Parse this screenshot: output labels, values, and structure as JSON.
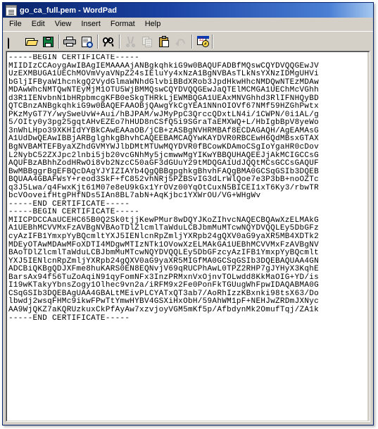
{
  "window": {
    "title": "go_ca_full.pem - WordPad",
    "icon": "wordpad-document-icon",
    "titlebar_color": "#0a246a",
    "chrome_color": "#d4d0c8"
  },
  "menubar": {
    "items": [
      {
        "label": "File",
        "name": "menu-file"
      },
      {
        "label": "Edit",
        "name": "menu-edit"
      },
      {
        "label": "View",
        "name": "menu-view"
      },
      {
        "label": "Insert",
        "name": "menu-insert"
      },
      {
        "label": "Format",
        "name": "menu-format"
      },
      {
        "label": "Help",
        "name": "menu-help"
      }
    ]
  },
  "toolbar": {
    "buttons": [
      {
        "name": "new-button",
        "icon": "new-document-icon",
        "enabled": true
      },
      {
        "name": "open-button",
        "icon": "open-folder-icon",
        "enabled": true
      },
      {
        "name": "save-button",
        "icon": "save-floppy-icon",
        "enabled": true
      },
      {
        "name": "print-button",
        "icon": "printer-icon",
        "enabled": true
      },
      {
        "name": "print-preview-button",
        "icon": "print-preview-icon",
        "enabled": true
      },
      {
        "name": "find-button",
        "icon": "binoculars-find-icon",
        "enabled": true
      },
      {
        "name": "cut-button",
        "icon": "scissors-cut-icon",
        "enabled": false
      },
      {
        "name": "copy-button",
        "icon": "copy-pages-icon",
        "enabled": false
      },
      {
        "name": "paste-button",
        "icon": "clipboard-paste-icon",
        "enabled": true
      },
      {
        "name": "undo-button",
        "icon": "undo-arrow-icon",
        "enabled": false
      },
      {
        "name": "date-time-button",
        "icon": "calendar-clock-icon",
        "enabled": true
      }
    ]
  },
  "document": {
    "lines": [
      "-----BEGIN CERTIFICATE-----",
      "MIIDIzCCAoygAwIBAgIEMAAAAjANBgkqhkiG9w0BAQUFADBfMQswCQYDVQQGEwJV",
      "UzEXMBUGA1UEChMOVmVyaVNpZ24sIEluYy4xNzA1BgNVBAsTLkNsYXNzIDMgUHVi",
      "bGljIFByaW1hcnkgQ2VydGlmaWNhdGlvbiBBdXRob3JpdHkwHhcNMDQwNTEzMDAw",
      "MDAwWhcNMTQwNTEyMjM1OTU5WjBMMQswCQYDVQQGEwJaQTElMCMGA1UEChMcVGhh",
      "d3R1IENvbnN1bHRpbmcgKFB0eSkgTHRkLjEWMBQGA1UEAxMNVGhhd3RlIFNHQyBD",
      "QTCBnzANBgkqhkiG9w0BAQEFAAOBjQAwgYkCgYEA1NNnOIOVf67NMf59HZGhPwtx",
      "PKzMyGT7Y/wySweUvW+Aui/hBJPAM/wJMyPpC3QrccQDxtLN4i/1CWPN/0i1AL/g",
      "5/OIty0y3pg25gqtAHvEZEo7hHUD8nCSfQ5i9SGraTaEMXWQ+L/HbIgbBpV8yeWo",
      "3nWhLHpo39XKHIdYYBkCAwEAAaOB/jCB+zASBgNVHRMBAf8ECDAGAQH/AgEAMAsG",
      "A1UdDwQEAwIBBjARBglghkgBhvhCAQEEBAMCAQYwKAYDVR0RBCEwH6QdMBsxGTAX",
      "BgNVBAMTEFByaXZhdGVMYWJlbDMtMTUwMQYDVR0fBCowKDAmoCSgIoYgaHR0cDov",
      "L2NybC52ZXJpc2lnbi5jb20vcGNhMy5jcmwwMgYIKwYBBQUHAQEEJjAkMCIGCCsG",
      "AQUFBzABhhZodHRwOi8vb2NzcC50aGF3dGUuY29tMDQGA1UdJQQtMCsGCCsGAQUF",
      "BwMBBggrBgEFBQcDAgYJYIZIAYb4QgQBBgpghkgBhvhFAQgBMA0GCSqGSIb3DQEB",
      "BQUAA4GBAFWsY+reod3SkF+fC852vhNRj5PZBSvIG3dLrWlQoe7e3P3bB+noOZTc",
      "q3J5Lwa/q4FwxKjt61M07e8eU9kGx1YrOVz00YqOtCuxN5BICEI1xT6Ky3/rbwTR",
      "bcVOoveifHtgPHfNDs5IAn8BL7abN+AqKjbc1YXWrOU/VG+WHgWv",
      "-----END CERTIFICATE-----",
      "-----BEGIN CERTIFICATE-----",
      "MIICPDCCAaUCEHC65B0Q2Sk0tjjKewPMur8wDQYJKoZIhvcNAQECBQAwXzELMAkG",
      "A1UEBhMCVVMxFzAVBgNVBAoTDlZlcmlTaWduLCBJbmMuMTcwNQYDVQQLEy5DbGFz",
      "cyAzIFB1YmxpYyBQcmltYXJ5IENlcnRpZmljYXRpb24gQXV0aG9yaXR5MB4XDTk2",
      "MDEyOTAwMDAwMFoXDTI4MDgwMTIzNTk1OVowXzELMAkGA1UEBhMCVVMxFzAVBgNV",
      "BAoTDlZlcmlTaWduLCBJbmMuMTcwNQYDVQQLEy5DbGFzcyAzIFB1YmxpYyBQcmlt",
      "YXJ5IENlcnRpZmljYXRpb24gQXV0aG9yaXR5MIGfMA0GCSqGSIb3DQEBAQUAA4GN",
      "ADCBiQKBgQDJXFme8huKARS0EN8EQNvjV69qRUCPhAwL0TPZ2RHP7gJYHyX3KqhE",
      "BarsAx94f56TuZoAqiN91qyFomNFx3InzPRMxnVxOjnvTOLwdd8KkMaOIG+YD/is",
      "I19wKTakyYbnsZogy1Olhec9vn2a/iRFM9x2Fe0PonFkTGUugWhFpwIDAQABMA0G",
      "CSqGSIb3DQEBAgUAA4GBALtMEivPLCYATxQT3ab7/AoRhIzzKBxnki98tsX63/Do",
      "lbwdj2wsqFHMc9ikwFPwTtYmwHYBV4GSXiHxObH/59AhWM1pF+NEHJwZRDmJXNyc",
      "AA9WjQKZ7aKQRUzkuxCkPfAyAw7xzvjoyVGM5mKf5p/AfbdynMk2OmufTqj/ZA1k",
      "-----END CERTIFICATE-----"
    ]
  }
}
